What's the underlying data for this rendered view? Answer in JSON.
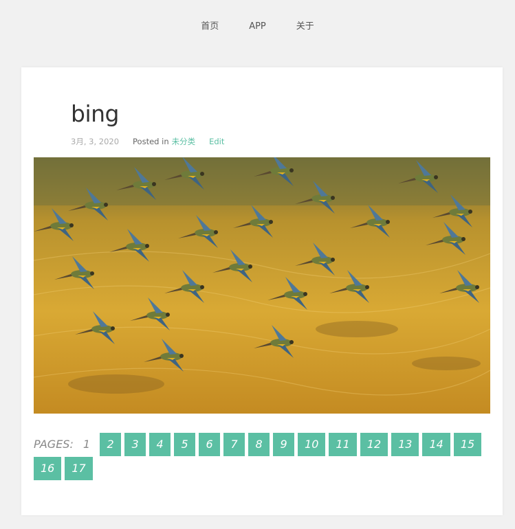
{
  "nav": {
    "items": [
      "首页",
      "APP",
      "关于"
    ]
  },
  "post": {
    "title": "bing",
    "date": "3月, 3, 2020",
    "posted_in": "Posted in",
    "category": "未分类",
    "edit": "Edit"
  },
  "pagination": {
    "label": "PAGES:",
    "current": "1",
    "links": [
      "2",
      "3",
      "4",
      "5",
      "6",
      "7",
      "8",
      "9",
      "10",
      "11",
      "12",
      "13",
      "14",
      "15",
      "16",
      "17"
    ]
  },
  "colors": {
    "accent": "#5bbfa3",
    "background": "#f1f1f1"
  }
}
